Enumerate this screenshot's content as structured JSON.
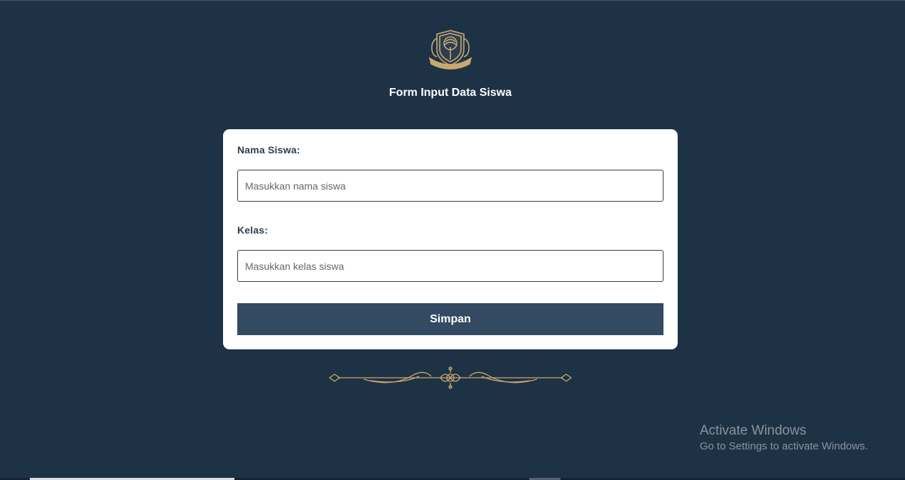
{
  "page": {
    "title": "Form Input Data Siswa"
  },
  "form": {
    "name_label": "Nama Siswa:",
    "name_placeholder": "Masukkan nama siswa",
    "name_value": "",
    "class_label": "Kelas:",
    "class_placeholder": "Masukkan kelas siswa",
    "class_value": "",
    "submit_label": "Simpan"
  },
  "icons": {
    "logo": "school-crest-icon",
    "ornament": "gold-flourish-divider"
  },
  "watermark": {
    "title": "Activate Windows",
    "subtitle": "Go to Settings to activate Windows."
  },
  "colors": {
    "background": "#1e3246",
    "card": "#ffffff",
    "button": "#344a63",
    "label": "#2c3e50",
    "gold": "#c9a96b"
  }
}
